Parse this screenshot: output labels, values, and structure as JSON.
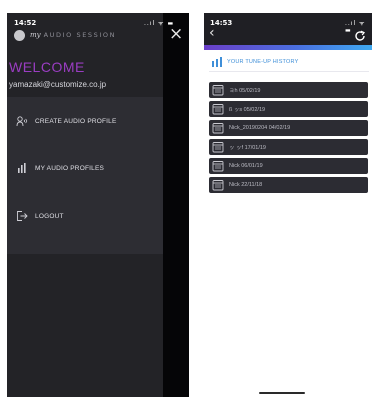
{
  "left_screen": {
    "status_time": "14:52",
    "status_icons": "..ıl ᯤ ▬",
    "logo_my": "my",
    "logo_text": "AUDIO SESSION",
    "close_icon": "close-icon",
    "welcome": "WELCOME",
    "email": "yamazaki@customize.co.jp",
    "menu": [
      {
        "label": "CREATE AUDIO PROFILE",
        "icon": "create-profile-icon"
      },
      {
        "label": "MY AUDIO PROFILES",
        "icon": "bars-icon"
      },
      {
        "label": "LOGOUT",
        "icon": "logout-icon"
      }
    ],
    "colors": {
      "welcome": "#9a3dc2",
      "panel": "#232327",
      "panel_upper": "#2d2d33"
    }
  },
  "right_screen": {
    "status_time": "14:53",
    "status_icons": "..ıl ᯤ ▬",
    "back_icon": "back-chevron-icon",
    "refresh_icon": "refresh-icon",
    "history_title": "YOUR TUNE-UP HISTORY",
    "history_items": [
      {
        "label": "ョh 05/02/19"
      },
      {
        "label": "ß ッs 05/02/19"
      },
      {
        "label": "Nick_20190204 04/02/19"
      },
      {
        "label": "ッ ッf 17/01/19"
      },
      {
        "label": "Nick 06/01/19"
      },
      {
        "label": "Nick 22/11/18"
      }
    ],
    "colors": {
      "accent": "#3f8fd8",
      "item_bg": "#2c2c33"
    }
  }
}
